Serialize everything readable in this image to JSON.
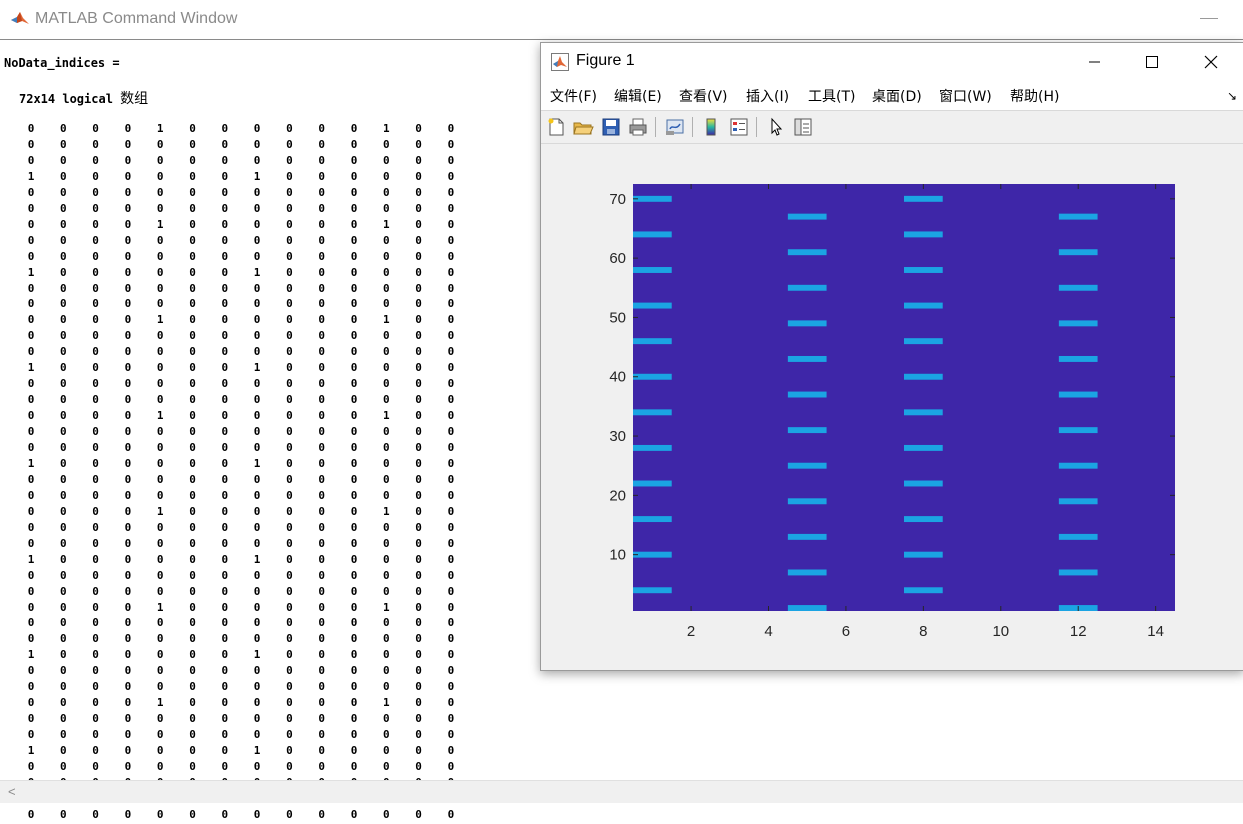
{
  "cmd_window": {
    "title": "MATLAB Command Window",
    "variable_line": "NoData_indices =",
    "dims_text": "72x14 logical",
    "dims_suffix": "数组",
    "matrix_rows": [
      [
        0,
        0,
        0,
        0,
        1,
        0,
        0,
        0,
        0,
        0,
        0,
        1,
        0,
        0
      ],
      [
        0,
        0,
        0,
        0,
        0,
        0,
        0,
        0,
        0,
        0,
        0,
        0,
        0,
        0
      ],
      [
        0,
        0,
        0,
        0,
        0,
        0,
        0,
        0,
        0,
        0,
        0,
        0,
        0,
        0
      ],
      [
        1,
        0,
        0,
        0,
        0,
        0,
        0,
        1,
        0,
        0,
        0,
        0,
        0,
        0
      ],
      [
        0,
        0,
        0,
        0,
        0,
        0,
        0,
        0,
        0,
        0,
        0,
        0,
        0,
        0
      ],
      [
        0,
        0,
        0,
        0,
        0,
        0,
        0,
        0,
        0,
        0,
        0,
        0,
        0,
        0
      ],
      [
        0,
        0,
        0,
        0,
        1,
        0,
        0,
        0,
        0,
        0,
        0,
        1,
        0,
        0
      ],
      [
        0,
        0,
        0,
        0,
        0,
        0,
        0,
        0,
        0,
        0,
        0,
        0,
        0,
        0
      ],
      [
        0,
        0,
        0,
        0,
        0,
        0,
        0,
        0,
        0,
        0,
        0,
        0,
        0,
        0
      ],
      [
        1,
        0,
        0,
        0,
        0,
        0,
        0,
        1,
        0,
        0,
        0,
        0,
        0,
        0
      ],
      [
        0,
        0,
        0,
        0,
        0,
        0,
        0,
        0,
        0,
        0,
        0,
        0,
        0,
        0
      ],
      [
        0,
        0,
        0,
        0,
        0,
        0,
        0,
        0,
        0,
        0,
        0,
        0,
        0,
        0
      ],
      [
        0,
        0,
        0,
        0,
        1,
        0,
        0,
        0,
        0,
        0,
        0,
        1,
        0,
        0
      ],
      [
        0,
        0,
        0,
        0,
        0,
        0,
        0,
        0,
        0,
        0,
        0,
        0,
        0,
        0
      ],
      [
        0,
        0,
        0,
        0,
        0,
        0,
        0,
        0,
        0,
        0,
        0,
        0,
        0,
        0
      ],
      [
        1,
        0,
        0,
        0,
        0,
        0,
        0,
        1,
        0,
        0,
        0,
        0,
        0,
        0
      ],
      [
        0,
        0,
        0,
        0,
        0,
        0,
        0,
        0,
        0,
        0,
        0,
        0,
        0,
        0
      ],
      [
        0,
        0,
        0,
        0,
        0,
        0,
        0,
        0,
        0,
        0,
        0,
        0,
        0,
        0
      ],
      [
        0,
        0,
        0,
        0,
        1,
        0,
        0,
        0,
        0,
        0,
        0,
        1,
        0,
        0
      ],
      [
        0,
        0,
        0,
        0,
        0,
        0,
        0,
        0,
        0,
        0,
        0,
        0,
        0,
        0
      ],
      [
        0,
        0,
        0,
        0,
        0,
        0,
        0,
        0,
        0,
        0,
        0,
        0,
        0,
        0
      ],
      [
        1,
        0,
        0,
        0,
        0,
        0,
        0,
        1,
        0,
        0,
        0,
        0,
        0,
        0
      ],
      [
        0,
        0,
        0,
        0,
        0,
        0,
        0,
        0,
        0,
        0,
        0,
        0,
        0,
        0
      ],
      [
        0,
        0,
        0,
        0,
        0,
        0,
        0,
        0,
        0,
        0,
        0,
        0,
        0,
        0
      ],
      [
        0,
        0,
        0,
        0,
        1,
        0,
        0,
        0,
        0,
        0,
        0,
        1,
        0,
        0
      ],
      [
        0,
        0,
        0,
        0,
        0,
        0,
        0,
        0,
        0,
        0,
        0,
        0,
        0,
        0
      ],
      [
        0,
        0,
        0,
        0,
        0,
        0,
        0,
        0,
        0,
        0,
        0,
        0,
        0,
        0
      ],
      [
        1,
        0,
        0,
        0,
        0,
        0,
        0,
        1,
        0,
        0,
        0,
        0,
        0,
        0
      ],
      [
        0,
        0,
        0,
        0,
        0,
        0,
        0,
        0,
        0,
        0,
        0,
        0,
        0,
        0
      ],
      [
        0,
        0,
        0,
        0,
        0,
        0,
        0,
        0,
        0,
        0,
        0,
        0,
        0,
        0
      ],
      [
        0,
        0,
        0,
        0,
        1,
        0,
        0,
        0,
        0,
        0,
        0,
        1,
        0,
        0
      ],
      [
        0,
        0,
        0,
        0,
        0,
        0,
        0,
        0,
        0,
        0,
        0,
        0,
        0,
        0
      ],
      [
        0,
        0,
        0,
        0,
        0,
        0,
        0,
        0,
        0,
        0,
        0,
        0,
        0,
        0
      ],
      [
        1,
        0,
        0,
        0,
        0,
        0,
        0,
        1,
        0,
        0,
        0,
        0,
        0,
        0
      ],
      [
        0,
        0,
        0,
        0,
        0,
        0,
        0,
        0,
        0,
        0,
        0,
        0,
        0,
        0
      ],
      [
        0,
        0,
        0,
        0,
        0,
        0,
        0,
        0,
        0,
        0,
        0,
        0,
        0,
        0
      ],
      [
        0,
        0,
        0,
        0,
        1,
        0,
        0,
        0,
        0,
        0,
        0,
        1,
        0,
        0
      ],
      [
        0,
        0,
        0,
        0,
        0,
        0,
        0,
        0,
        0,
        0,
        0,
        0,
        0,
        0
      ],
      [
        0,
        0,
        0,
        0,
        0,
        0,
        0,
        0,
        0,
        0,
        0,
        0,
        0,
        0
      ],
      [
        1,
        0,
        0,
        0,
        0,
        0,
        0,
        1,
        0,
        0,
        0,
        0,
        0,
        0
      ],
      [
        0,
        0,
        0,
        0,
        0,
        0,
        0,
        0,
        0,
        0,
        0,
        0,
        0,
        0
      ],
      [
        0,
        0,
        0,
        0,
        0,
        0,
        0,
        0,
        0,
        0,
        0,
        0,
        0,
        0
      ],
      [
        0,
        0,
        0,
        0,
        1,
        0,
        0,
        0,
        0,
        0,
        0,
        1,
        0,
        0
      ],
      [
        0,
        0,
        0,
        0,
        0,
        0,
        0,
        0,
        0,
        0,
        0,
        0,
        0,
        0
      ]
    ],
    "scroll_left_glyph": "<"
  },
  "figure_window": {
    "title": "Figure 1",
    "menu": [
      "文件(F)",
      "编辑(E)",
      "查看(V)",
      "插入(I)",
      "工具(T)",
      "桌面(D)",
      "窗口(W)",
      "帮助(H)"
    ],
    "dock_glyph": "↘",
    "toolbar_icons": [
      "new-figure-icon",
      "open-file-icon",
      "save-icon",
      "print-icon",
      "link-plot-icon",
      "colorbar-icon",
      "legend-icon",
      "edit-plot-arrow-icon",
      "property-inspector-icon"
    ]
  },
  "chart_data": {
    "type": "heatmap",
    "description_source": "imagesc of NoData_indices (72x14 logical)",
    "xticks": [
      2,
      4,
      6,
      8,
      10,
      12,
      14
    ],
    "yticks": [
      10,
      20,
      30,
      40,
      50,
      60,
      70
    ],
    "xlim": [
      0.5,
      14.5
    ],
    "ylim": [
      0.5,
      72.5
    ],
    "y_direction": "normal",
    "colors": {
      "zero": "#3e26a8",
      "one": "#1ba4e3"
    },
    "true_cells": {
      "1": [
        4,
        10,
        16,
        22,
        28,
        34,
        40,
        46,
        52,
        58,
        64,
        70
      ],
      "5": [
        1,
        7,
        13,
        19,
        25,
        31,
        37,
        43,
        49,
        55,
        61,
        67
      ],
      "8": [
        4,
        10,
        16,
        22,
        28,
        34,
        40,
        46,
        52,
        58,
        64,
        70
      ],
      "12": [
        1,
        7,
        13,
        19,
        25,
        31,
        37,
        43,
        49,
        55,
        61,
        67
      ]
    }
  }
}
